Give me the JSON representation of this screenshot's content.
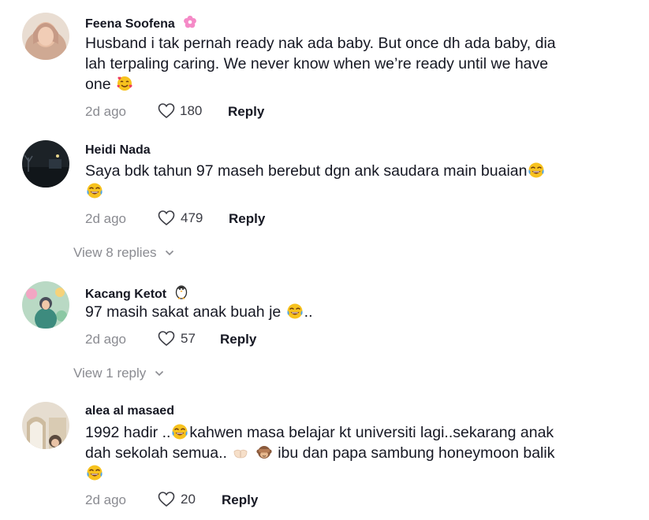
{
  "comments": [
    {
      "author": "Feena Soofena",
      "badge_icon": "pink-flower-icon",
      "text_lines": [
        "Husband i tak pernah ready nak ada baby. But once dh ada baby, dia",
        "lah terpaling caring. We never know when we’re ready until we have",
        "one"
      ],
      "emoji_icons": [
        "smiling-face-with-hearts-icon"
      ],
      "time": "2d ago",
      "likes": "180",
      "reply_label": "Reply"
    },
    {
      "author": "Heidi Nada",
      "text_lines": [
        "Saya bdk tahun 97 maseh berebut dgn ank saudara main buaian"
      ],
      "emoji_icons": [
        "tears-of-joy-icon",
        "tears-of-joy-icon"
      ],
      "time": "2d ago",
      "likes": "479",
      "reply_label": "Reply",
      "view_replies": "View 8 replies"
    },
    {
      "author": "Kacang Ketot",
      "badge_icon": "penguin-icon",
      "text_parts": [
        "97 masih sakat anak buah je ",
        ".."
      ],
      "emoji_icons": [
        "tears-of-joy-icon"
      ],
      "time": "2d ago",
      "likes": "57",
      "reply_label": "Reply",
      "view_replies": "View 1 reply"
    },
    {
      "author": "alea al masaed",
      "text_parts": [
        "1992 hadir ..",
        "kahwen masa belajar kt universiti lagi..sekarang anak",
        "dah sekolah semua..",
        "ibu dan papa sambung honeymoon balik"
      ],
      "emoji_icons": [
        "tears-of-joy-icon",
        "palms-up-together-icon",
        "see-no-evil-monkey-icon",
        "tears-of-joy-icon"
      ],
      "time": "2d ago",
      "likes": "20",
      "reply_label": "Reply"
    }
  ],
  "colors": {
    "text": "#161823",
    "muted": "#8a8b91",
    "likes": "#3b3c44"
  }
}
